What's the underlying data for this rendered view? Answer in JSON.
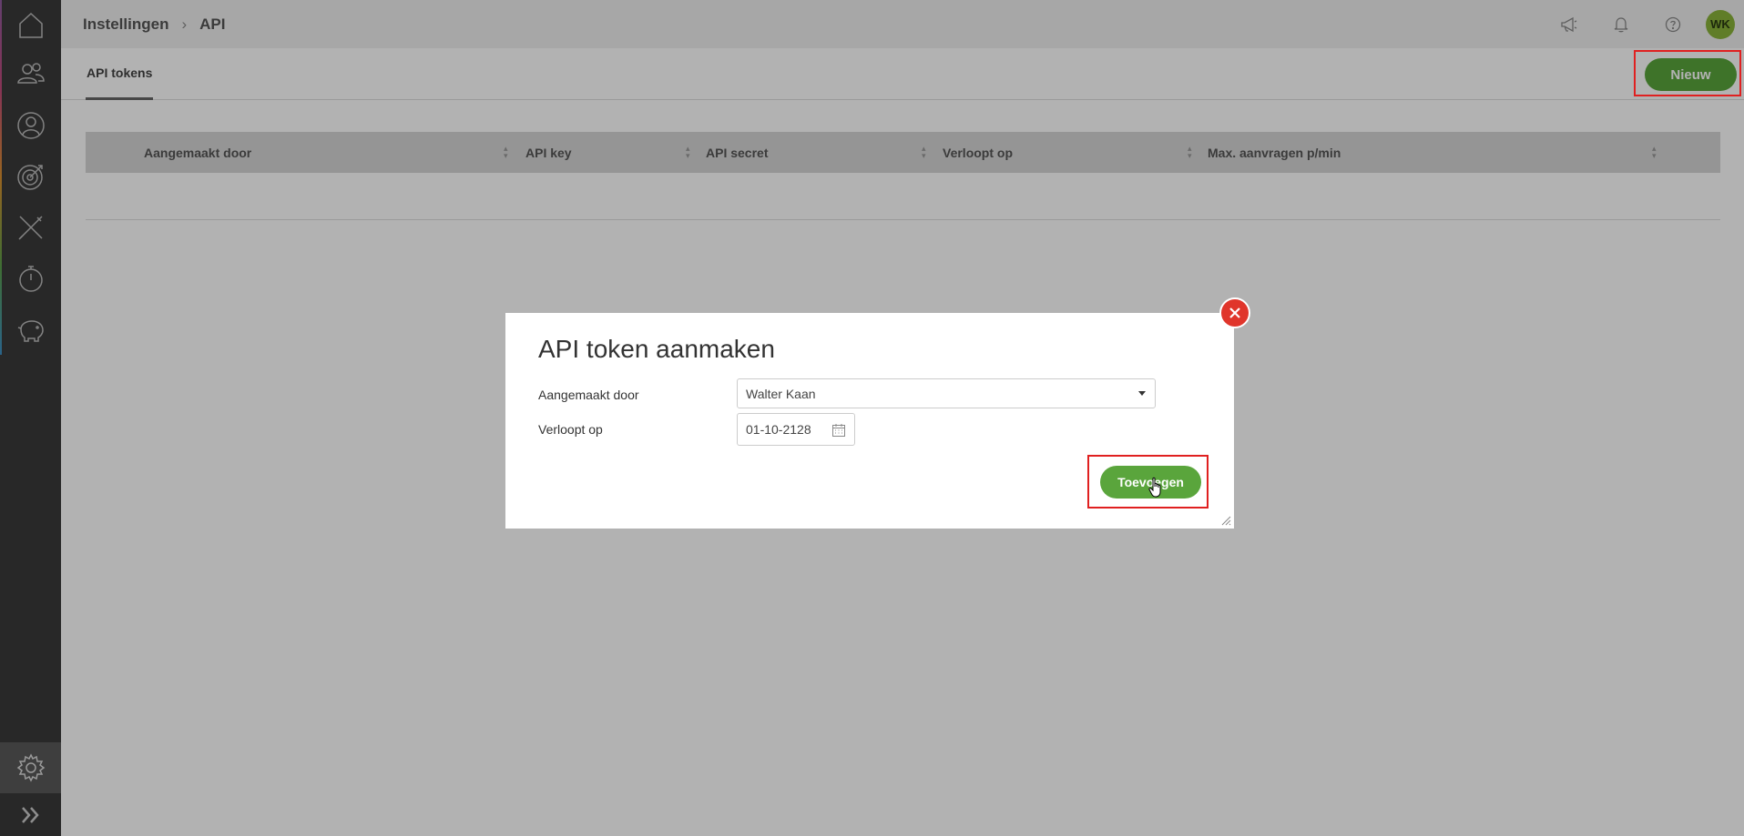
{
  "sidebar": {
    "items": [
      {
        "icon": "home-icon"
      },
      {
        "icon": "people-icon"
      },
      {
        "icon": "user-icon"
      },
      {
        "icon": "target-icon"
      },
      {
        "icon": "tools-icon"
      },
      {
        "icon": "stopwatch-icon"
      },
      {
        "icon": "piggy-bank-icon"
      }
    ],
    "settings_icon": "gear-icon",
    "expand_icon": "double-chevron-right-icon"
  },
  "header": {
    "breadcrumb": [
      "Instellingen",
      "API"
    ],
    "icons": [
      "megaphone-icon",
      "bell-icon",
      "help-icon"
    ],
    "avatar_initials": "WK"
  },
  "subnav": {
    "tab_label": "API tokens",
    "new_button_label": "Nieuw"
  },
  "table": {
    "columns": [
      "Aangemaakt door",
      "API key",
      "API secret",
      "Verloopt op",
      "Max. aanvragen p/min"
    ]
  },
  "modal": {
    "title": "API token aanmaken",
    "created_by_label": "Aangemaakt door",
    "created_by_value": "Walter Kaan",
    "expires_label": "Verloopt op",
    "expires_value": "01-10-2128",
    "add_button_label": "Toevoegen"
  },
  "colors": {
    "accent_green": "#5aa53c",
    "avatar_green": "#8ab43a",
    "close_red": "#e0352b",
    "highlight_red": "#e02020",
    "sidebar_bg": "#3a3a3a"
  }
}
